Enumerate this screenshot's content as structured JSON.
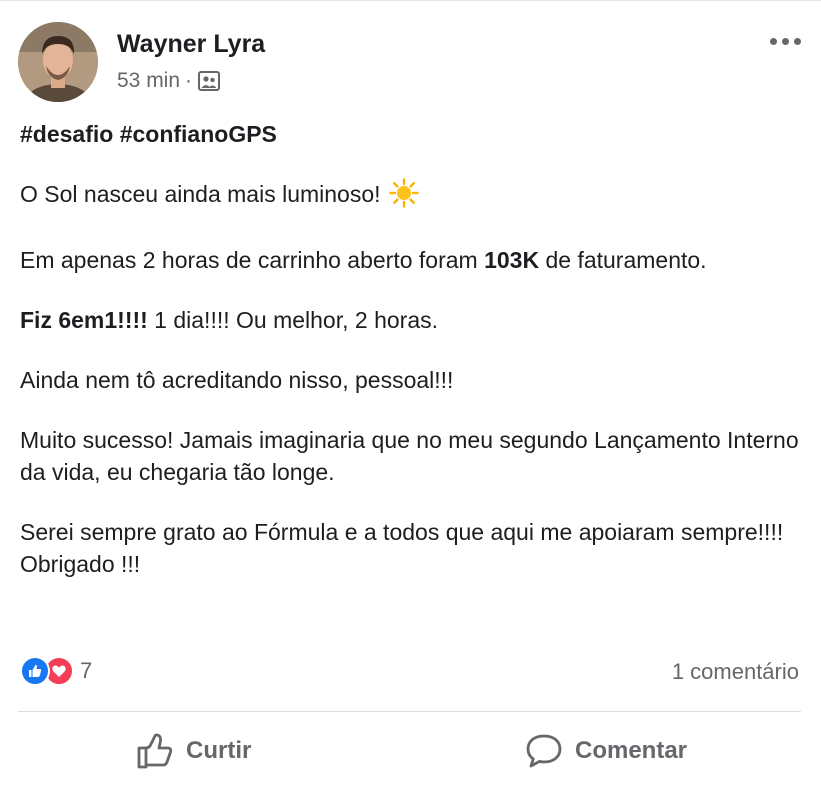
{
  "post": {
    "author": "Wayner Lyra",
    "time": "53 min",
    "separator": "·",
    "audience_icon": "friends-icon",
    "paragraphs": {
      "hashtags": "#desafio #confianoGPS",
      "p1": "O Sol nasceu ainda mais luminoso!",
      "p2_a": "Em apenas 2 horas de carrinho aberto foram ",
      "p2_b": "103K",
      "p2_c": " de faturamento.",
      "p3_a": "Fiz 6em1!!!!",
      "p3_b": " 1 dia!!!! Ou melhor, 2 horas.",
      "p4": "Ainda nem tô acreditando nisso, pessoal!!!",
      "p5": "Muito sucesso! Jamais imaginaria que no meu segundo Lançamento Interno da vida, eu chegaria tão longe.",
      "p6": "Serei sempre grato ao Fórmula e a todos que aqui me apoiaram sempre!!!! Obrigado !!!"
    }
  },
  "reactions": {
    "count": "7",
    "comments": "1 comentário",
    "icons": [
      "like-reaction-icon",
      "love-reaction-icon"
    ]
  },
  "actions": {
    "like_label": "Curtir",
    "comment_label": "Comentar"
  },
  "colors": {
    "like_blue": "#1877f2",
    "love_red": "#f33e58",
    "secondary_text": "#65676b"
  }
}
